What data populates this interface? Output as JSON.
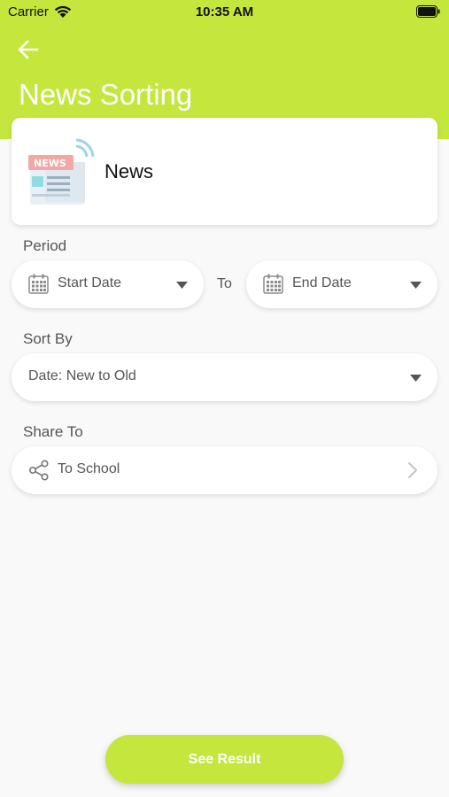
{
  "status_bar": {
    "carrier": "Carrier",
    "time": "10:35 AM"
  },
  "header": {
    "title": "News Sorting",
    "back_icon": "arrow-left-icon"
  },
  "category": {
    "title": "News",
    "badge_text": "NEWS",
    "icon": "newspaper-illustration"
  },
  "period": {
    "label": "Period",
    "start_placeholder": "Start Date",
    "separator": "To",
    "end_placeholder": "End Date"
  },
  "sort": {
    "label": "Sort By",
    "selected": "Date: New to Old"
  },
  "share": {
    "label": "Share To",
    "value": "To School"
  },
  "actions": {
    "see_result": "See Result"
  },
  "colors": {
    "accent": "#c5e63d",
    "background": "#f9f9f9",
    "text": "#555555"
  }
}
